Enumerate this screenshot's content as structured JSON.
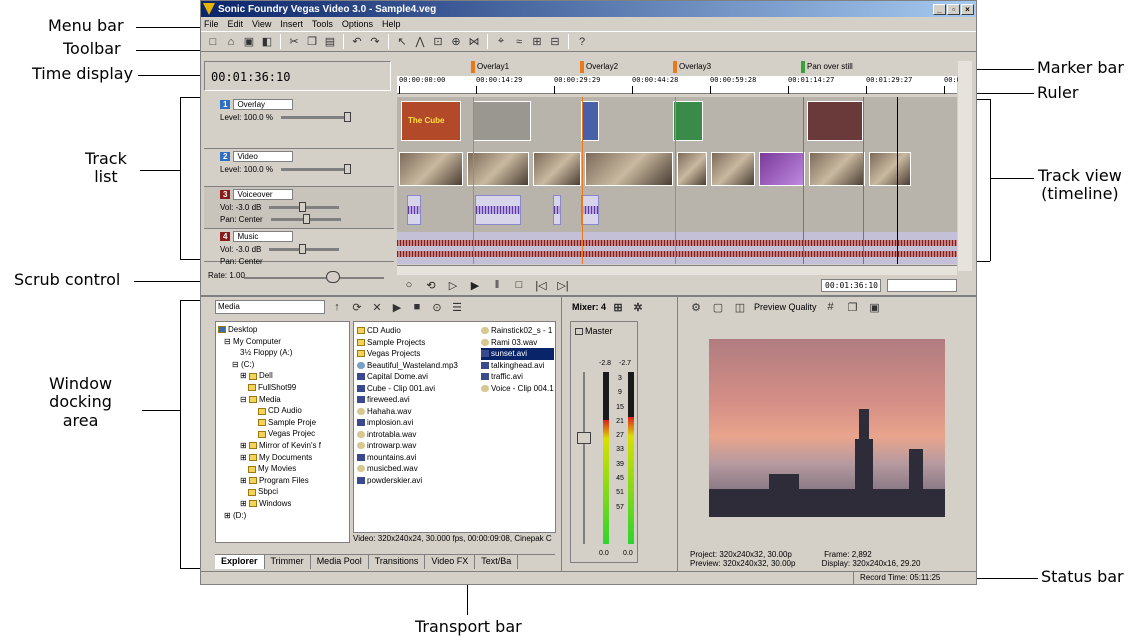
{
  "window": {
    "title": "Sonic Foundry Vegas Video 3.0 - Sample4.veg",
    "buttons": [
      "_",
      "▫",
      "×"
    ]
  },
  "menu": [
    "File",
    "Edit",
    "View",
    "Insert",
    "Tools",
    "Options",
    "Help"
  ],
  "timeline": {
    "time_display": "00:01:36:10",
    "markers": [
      "Overlay1",
      "Overlay2",
      "Overlay3",
      "Pan over still"
    ],
    "ruler_ticks": [
      "00:00:00:00",
      "00:00:14:29",
      "00:00:29:29",
      "00:00:44:28",
      "00:00:59:28",
      "00:01:14:27",
      "00:01:29:27",
      "00:0"
    ],
    "tracks": [
      {
        "num": "1",
        "name": "Overlay",
        "line1": "Level: 100.0 %",
        "line2": ""
      },
      {
        "num": "2",
        "name": "Video",
        "line1": "Level: 100.0 %",
        "line2": ""
      },
      {
        "num": "3",
        "name": "Voiceover",
        "line1": "Vol:    -3.0 dB",
        "line2": "Pan:    Center"
      },
      {
        "num": "4",
        "name": "Music",
        "line1": "Vol:    -3.0 dB",
        "line2": "Pan:    Center"
      }
    ],
    "clip_title": "The Cube",
    "scrub_rate": "Rate: 1.00",
    "transport_time": "00:01:36:10"
  },
  "explorer": {
    "location": "Media",
    "tree": [
      "Desktop",
      "My Computer",
      "3½ Floppy (A:)",
      "(C:)",
      "Dell",
      "FullShot99",
      "Media",
      "CD Audio",
      "Sample Proje",
      "Vegas Projec",
      "Mirror of Kevin's f",
      "My Documents",
      "My Movies",
      "Program Files",
      "Sbpci",
      "Windows",
      "(D:)"
    ],
    "files_col1": [
      {
        "name": "CD Audio",
        "type": "folder"
      },
      {
        "name": "Sample Projects",
        "type": "folder"
      },
      {
        "name": "Vegas Projects",
        "type": "folder"
      },
      {
        "name": "Beautiful_Wasteland.mp3",
        "type": "mp3"
      },
      {
        "name": "Capital Dome.avi",
        "type": "avi"
      },
      {
        "name": "Cube - Clip 001.avi",
        "type": "avi"
      },
      {
        "name": "fireweed.avi",
        "type": "avi"
      },
      {
        "name": "Hahaha.wav",
        "type": "wav"
      },
      {
        "name": "implosion.avi",
        "type": "avi"
      },
      {
        "name": "introtabla.wav",
        "type": "wav"
      },
      {
        "name": "introwarp.wav",
        "type": "wav"
      },
      {
        "name": "mountains.avi",
        "type": "avi"
      },
      {
        "name": "musicbed.wav",
        "type": "wav"
      },
      {
        "name": "powderskier.avi",
        "type": "avi"
      }
    ],
    "files_col2": [
      {
        "name": "Rainstick02_s - 1",
        "type": "wav"
      },
      {
        "name": "Rami 03.wav",
        "type": "wav"
      },
      {
        "name": "sunset.avi",
        "type": "avi",
        "selected": true
      },
      {
        "name": "talkinghead.avi",
        "type": "avi"
      },
      {
        "name": "traffic.avi",
        "type": "avi"
      },
      {
        "name": "Voice - Clip 004.1",
        "type": "wav"
      }
    ],
    "file_info": "Video: 320x240x24, 30.000 fps, 00:00:09:08, Cinepak C",
    "tabs": [
      "Explorer",
      "Trimmer",
      "Media Pool",
      "Transitions",
      "Video FX",
      "Text/Ba"
    ]
  },
  "mixer": {
    "header": "Mixer: 4",
    "master_label": "Master",
    "peak_left": "-2.8",
    "peak_right": "-2.7",
    "scale": [
      "3",
      "9",
      "15",
      "21",
      "27",
      "33",
      "39",
      "45",
      "51",
      "57"
    ],
    "bottom_left": "0.0",
    "bottom_right": "0.0",
    "level_left": 0.72,
    "level_right": 0.74
  },
  "preview": {
    "quality_label": "Preview Quality",
    "project_label": "Project:",
    "project_value": "320x240x32, 30.00p",
    "preview_label": "Preview:",
    "preview_value": "320x240x32, 30.00p",
    "frame_label": "Frame:",
    "frame_value": "2,892",
    "display_label": "Display:",
    "display_value": "320x240x16, 29.20"
  },
  "status": {
    "record_time": "Record Time: 05:11:25"
  },
  "callouts": {
    "menu_bar": "Menu bar",
    "toolbar": "Toolbar",
    "time_display": "Time display",
    "track_list": "Track\nlist",
    "scrub_control": "Scrub control",
    "window_docking": "Window\ndocking\narea",
    "marker_bar": "Marker bar",
    "ruler": "Ruler",
    "track_view": "Track view\n(timeline)",
    "status_bar": "Status bar",
    "transport_bar": "Transport bar"
  }
}
